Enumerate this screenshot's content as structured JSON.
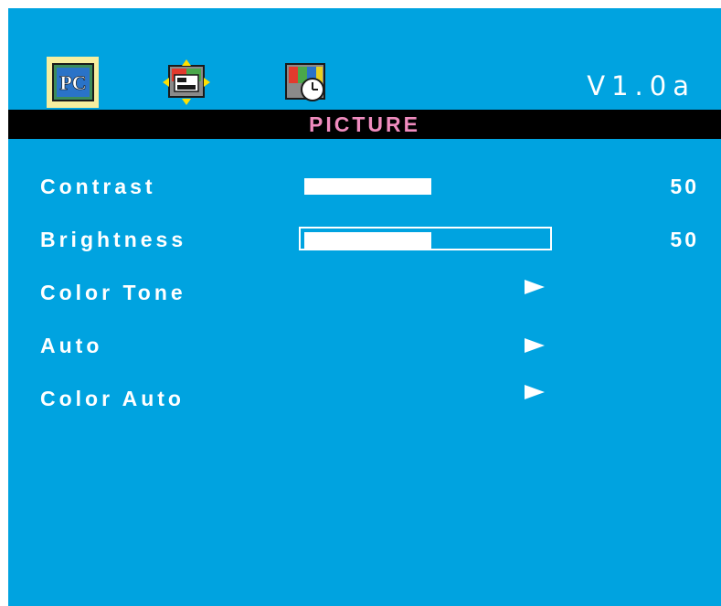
{
  "header": {
    "version": "V1.0a",
    "tabs": [
      {
        "name": "pc-tab",
        "icon": "pc-icon",
        "label": "PC",
        "active": true
      },
      {
        "name": "position-tab",
        "icon": "position-icon",
        "active": false
      },
      {
        "name": "time-tab",
        "icon": "clock-icon",
        "active": false
      }
    ]
  },
  "title": "PICTURE",
  "items": [
    {
      "label": "Contrast",
      "value": "50",
      "level": 0.5
    },
    {
      "label": "Brightness",
      "value": "50",
      "level": 0.5,
      "selected": true
    },
    {
      "label": "Color Tone"
    },
    {
      "label": "Auto"
    },
    {
      "label": "Color Auto"
    }
  ],
  "colors": {
    "background": "#00a3e0",
    "title_text": "#f08cbf",
    "title_bar": "#000000",
    "active_tab": "#f6ee9f"
  }
}
